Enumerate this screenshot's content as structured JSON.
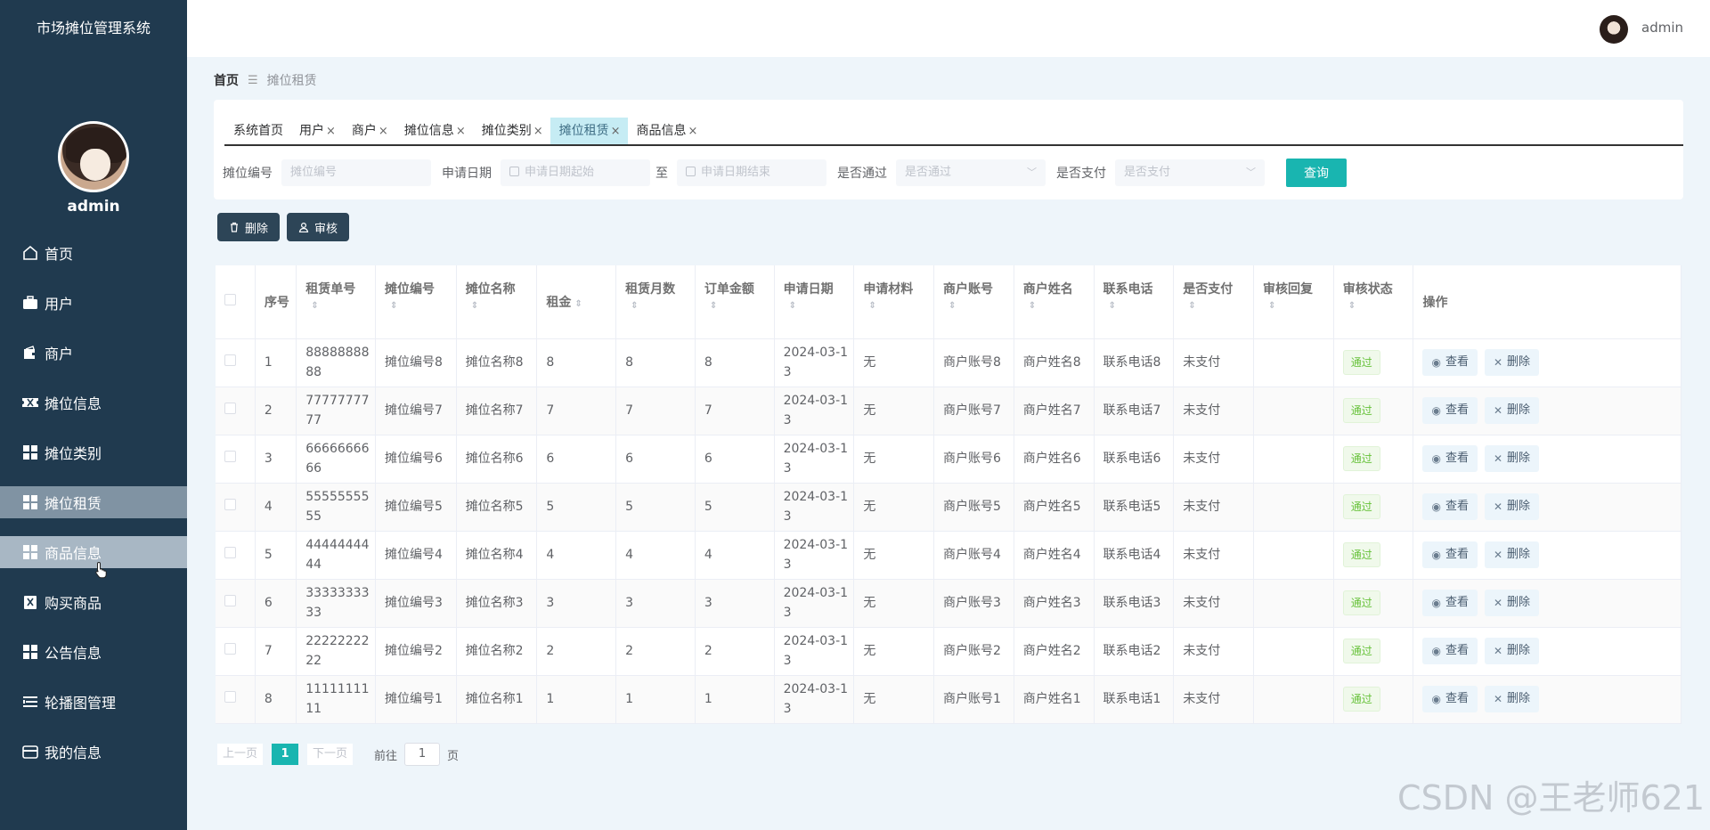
{
  "app_title": "市场摊位管理系统",
  "user": {
    "name": "admin"
  },
  "sidebar": {
    "items": [
      {
        "label": "首页",
        "icon": "home-icon"
      },
      {
        "label": "用户",
        "icon": "briefcase-icon"
      },
      {
        "label": "商户",
        "icon": "wallet-icon"
      },
      {
        "label": "摊位信息",
        "icon": "ticket-icon"
      },
      {
        "label": "摊位类别",
        "icon": "grid-icon"
      },
      {
        "label": "摊位租赁",
        "icon": "grid-icon",
        "state": "active"
      },
      {
        "label": "商品信息",
        "icon": "grid-icon",
        "state": "hover"
      },
      {
        "label": "购买商品",
        "icon": "cart-icon"
      },
      {
        "label": "公告信息",
        "icon": "grid-icon"
      },
      {
        "label": "轮播图管理",
        "icon": "list-icon"
      },
      {
        "label": "我的信息",
        "icon": "card-icon"
      }
    ]
  },
  "breadcrumb": {
    "home": "首页",
    "current": "摊位租赁"
  },
  "tabs": [
    {
      "label": "系统首页",
      "closable": false
    },
    {
      "label": "用户",
      "closable": true
    },
    {
      "label": "商户",
      "closable": true
    },
    {
      "label": "摊位信息",
      "closable": true
    },
    {
      "label": "摊位类别",
      "closable": true
    },
    {
      "label": "摊位租赁",
      "closable": true,
      "active": true
    },
    {
      "label": "商品信息",
      "closable": true
    }
  ],
  "search": {
    "stall_no_label": "摊位编号",
    "stall_no_placeholder": "摊位编号",
    "date_label": "申请日期",
    "date_start_placeholder": "申请日期起始",
    "date_to": "至",
    "date_end_placeholder": "申请日期结束",
    "approved_label": "是否通过",
    "approved_placeholder": "是否通过",
    "paid_label": "是否支付",
    "paid_placeholder": "是否支付",
    "query_button": "查询"
  },
  "toolbar": {
    "delete_label": "删除",
    "audit_label": "审核"
  },
  "table": {
    "columns": [
      "序号",
      "租赁单号",
      "摊位编号",
      "摊位名称",
      "租金",
      "租赁月数",
      "订单金额",
      "申请日期",
      "申请材料",
      "商户账号",
      "商户姓名",
      "联系电话",
      "是否支付",
      "审核回复",
      "审核状态",
      "操作"
    ],
    "view_label": "查看",
    "delete_label": "删除",
    "rows": [
      [
        "1",
        "8888888888",
        "摊位编号8",
        "摊位名称8",
        "8",
        "8",
        "8",
        "2024-03-13",
        "无",
        "商户账号8",
        "商户姓名8",
        "联系电话8",
        "未支付",
        "",
        "通过"
      ],
      [
        "2",
        "7777777777",
        "摊位编号7",
        "摊位名称7",
        "7",
        "7",
        "7",
        "2024-03-13",
        "无",
        "商户账号7",
        "商户姓名7",
        "联系电话7",
        "未支付",
        "",
        "通过"
      ],
      [
        "3",
        "6666666666",
        "摊位编号6",
        "摊位名称6",
        "6",
        "6",
        "6",
        "2024-03-13",
        "无",
        "商户账号6",
        "商户姓名6",
        "联系电话6",
        "未支付",
        "",
        "通过"
      ],
      [
        "4",
        "5555555555",
        "摊位编号5",
        "摊位名称5",
        "5",
        "5",
        "5",
        "2024-03-13",
        "无",
        "商户账号5",
        "商户姓名5",
        "联系电话5",
        "未支付",
        "",
        "通过"
      ],
      [
        "5",
        "4444444444",
        "摊位编号4",
        "摊位名称4",
        "4",
        "4",
        "4",
        "2024-03-13",
        "无",
        "商户账号4",
        "商户姓名4",
        "联系电话4",
        "未支付",
        "",
        "通过"
      ],
      [
        "6",
        "3333333333",
        "摊位编号3",
        "摊位名称3",
        "3",
        "3",
        "3",
        "2024-03-13",
        "无",
        "商户账号3",
        "商户姓名3",
        "联系电话3",
        "未支付",
        "",
        "通过"
      ],
      [
        "7",
        "2222222222",
        "摊位编号2",
        "摊位名称2",
        "2",
        "2",
        "2",
        "2024-03-13",
        "无",
        "商户账号2",
        "商户姓名2",
        "联系电话2",
        "未支付",
        "",
        "通过"
      ],
      [
        "8",
        "1111111111",
        "摊位编号1",
        "摊位名称1",
        "1",
        "1",
        "1",
        "2024-03-13",
        "无",
        "商户账号1",
        "商户姓名1",
        "联系电话1",
        "未支付",
        "",
        "通过"
      ]
    ]
  },
  "pagination": {
    "prev": "上一页",
    "current": "1",
    "next": "下一页",
    "goto_label": "前往",
    "goto_value": "1",
    "page_suffix": "页"
  },
  "watermark": "CSDN @王老师621",
  "colors": {
    "sidebar_bg": "#203a4f",
    "accent": "#19b5b0",
    "success": "#67c23a"
  }
}
